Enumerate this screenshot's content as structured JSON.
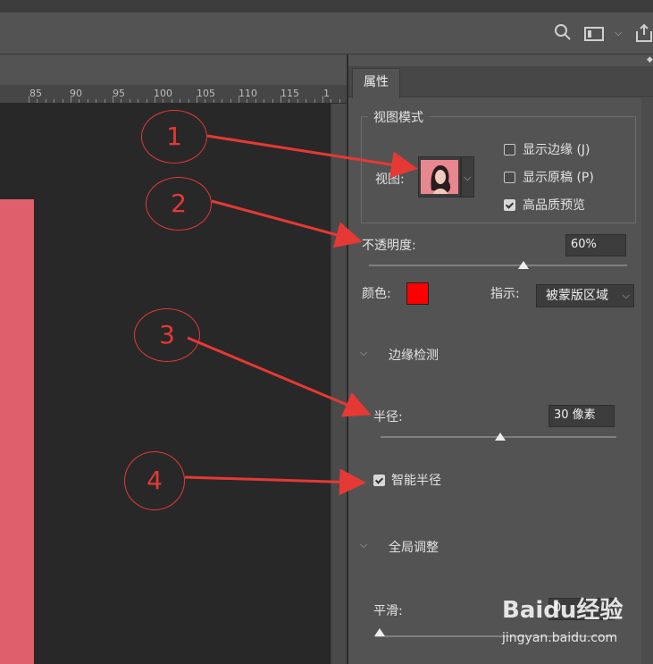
{
  "ruler": {
    "numbers": [
      "85",
      "90",
      "95",
      "100",
      "105",
      "110",
      "115",
      "1"
    ]
  },
  "panel": {
    "tab_label": "属性",
    "view_mode": {
      "group_title": "视图模式",
      "view_label": "视图:",
      "show_edge_label": "显示边缘 (J)",
      "show_edge_checked": false,
      "show_original_label": "显示原稿 (P)",
      "show_original_checked": false,
      "high_quality_label": "高品质预览",
      "high_quality_checked": true
    },
    "opacity": {
      "label": "不透明度:",
      "value": "60%",
      "level_percent": 60
    },
    "color": {
      "label": "颜色:",
      "swatch": "#ff0000"
    },
    "indicate": {
      "label": "指示:",
      "value": "被蒙版区域"
    },
    "edge_detection": {
      "section_title": "边缘检测",
      "radius_label": "半径:",
      "radius_value": "30 像素",
      "smart_radius_label": "智能半径",
      "smart_radius_checked": true
    },
    "global_refine": {
      "section_title": "全局调整",
      "smooth_label": "平滑:",
      "smooth_value": "0"
    }
  },
  "annotations": [
    "1",
    "2",
    "3",
    "4"
  ],
  "watermark": {
    "logo": "Baidu经验",
    "url": "jingyan.baidu.com"
  },
  "colors": {
    "accent_annotation": "#e53935",
    "canvas_pink": "#e05f6d"
  }
}
